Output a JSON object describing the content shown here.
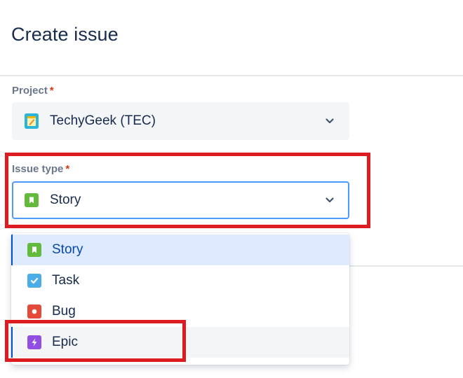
{
  "dialog": {
    "title": "Create issue"
  },
  "project": {
    "label": "Project",
    "required_mark": "*",
    "value": "TechyGeek (TEC)",
    "icon": "project-notepad-icon"
  },
  "issue_type": {
    "label": "Issue type",
    "required_mark": "*",
    "value": "Story",
    "icon": "story-icon",
    "options": [
      {
        "label": "Story",
        "icon": "story-icon",
        "color": "#63ba3c",
        "state": "selected"
      },
      {
        "label": "Task",
        "icon": "task-icon",
        "color": "#4bade8",
        "state": ""
      },
      {
        "label": "Bug",
        "icon": "bug-icon",
        "color": "#e5493a",
        "state": ""
      },
      {
        "label": "Epic",
        "icon": "epic-icon",
        "color": "#904ee2",
        "state": "hovered"
      }
    ]
  },
  "annotations": {
    "highlight_color": "#dd1c21"
  },
  "colors": {
    "focus_border": "#4c9aff",
    "selected_bg": "#deebff",
    "selected_text": "#0747a6",
    "required": "#de350b"
  }
}
